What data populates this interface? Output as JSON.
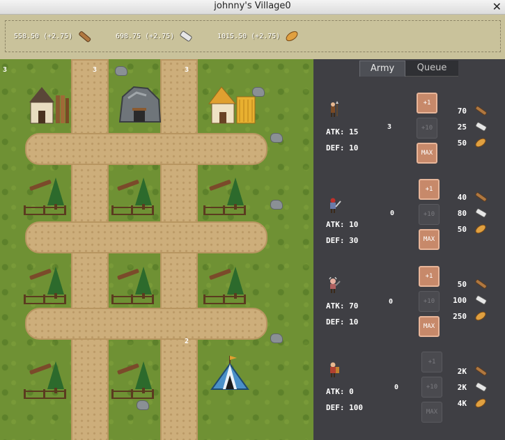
{
  "window": {
    "title": "johnny's Village0"
  },
  "resources": [
    {
      "text": "558.50 (+2.75)",
      "icon": "wood-log-icon"
    },
    {
      "text": "698.75 (+2.75)",
      "icon": "stone-brick-icon"
    },
    {
      "text": "1015.50 (+2.75)",
      "icon": "bread-icon"
    }
  ],
  "map": {
    "levels": {
      "lumber_mill": "3",
      "quarry": "3",
      "farm": "3",
      "top_left": "3",
      "barracks": "2"
    }
  },
  "tabs": {
    "army": "Army",
    "queue": "Queue"
  },
  "units": [
    {
      "name": "spearman",
      "atk": "ATK: 15",
      "def": "DEF: 10",
      "count": "3",
      "enabled": true,
      "costs": [
        "70",
        "25",
        "50"
      ]
    },
    {
      "name": "knight",
      "atk": "ATK: 10",
      "def": "DEF: 30",
      "count": "0",
      "enabled": true,
      "costs": [
        "40",
        "80",
        "50"
      ]
    },
    {
      "name": "berserker",
      "atk": "ATK: 70",
      "def": "DEF: 10",
      "count": "0",
      "enabled": true,
      "costs": [
        "50",
        "100",
        "250"
      ]
    },
    {
      "name": "guardian",
      "atk": "ATK: 0",
      "def": "DEF: 100",
      "count": "0",
      "enabled": false,
      "costs": [
        "2K",
        "2K",
        "4K"
      ]
    }
  ],
  "buttons": {
    "plus1": "+1",
    "plus10": "+10",
    "max": "MAX"
  },
  "colors": {
    "button_active": "#c7896a",
    "panel": "#3f3f44",
    "grass": "#6f9134",
    "road": "#cdae7b"
  }
}
